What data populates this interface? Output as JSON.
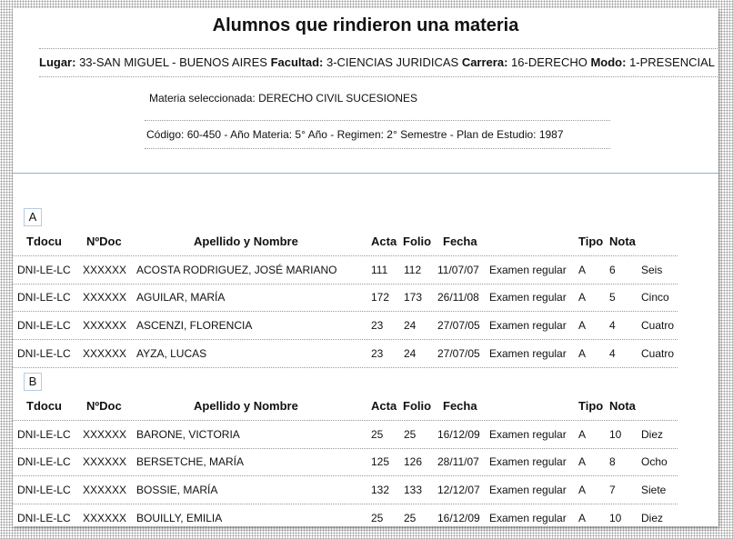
{
  "title": "Alumnos que rindieron una materia",
  "info": {
    "lugar_label": "Lugar:",
    "lugar_value": "33-SAN MIGUEL - BUENOS AIRES",
    "facultad_label": "Facultad:",
    "facultad_value": "3-CIENCIAS JURIDICAS",
    "carrera_label": "Carrera:",
    "carrera_value": "16-DERECHO",
    "modo_label": "Modo:",
    "modo_value": "1-PRESENCIAL"
  },
  "materia": "Materia seleccionada: DERECHO CIVIL SUCESIONES",
  "codigo": "Código: 60-450 - Año Materia: 5° Año - Regimen: 2° Semestre - Plan de Estudio: 1987",
  "columns": [
    "Tdocu",
    "NºDoc",
    "Apellido y Nombre",
    "Acta",
    "Folio",
    "Fecha",
    "Tipo",
    "Nota"
  ],
  "groups": [
    {
      "letter": "A",
      "rows": [
        {
          "tdocu": "DNI-LE-LC",
          "ndoc": "XXXXXX",
          "nombre": "ACOSTA RODRIGUEZ,  JOSÉ MARIANO",
          "acta": "111",
          "folio": "112",
          "fecha": "11/07/07",
          "examen": "Examen regular",
          "tipo": "A",
          "nota": "6",
          "nota_texto": "Seis"
        },
        {
          "tdocu": "DNI-LE-LC",
          "ndoc": "XXXXXX",
          "nombre": "AGUILAR, MARÍA",
          "acta": "172",
          "folio": "173",
          "fecha": "26/11/08",
          "examen": "Examen regular",
          "tipo": "A",
          "nota": "5",
          "nota_texto": "Cinco"
        },
        {
          "tdocu": "DNI-LE-LC",
          "ndoc": "XXXXXX",
          "nombre": "ASCENZI,  FLORENCIA",
          "acta": "23",
          "folio": "24",
          "fecha": "27/07/05",
          "examen": "Examen regular",
          "tipo": "A",
          "nota": "4",
          "nota_texto": "Cuatro"
        },
        {
          "tdocu": "DNI-LE-LC",
          "ndoc": "XXXXXX",
          "nombre": "AYZA, LUCAS",
          "acta": "23",
          "folio": "24",
          "fecha": "27/07/05",
          "examen": "Examen regular",
          "tipo": "A",
          "nota": "4",
          "nota_texto": "Cuatro"
        }
      ]
    },
    {
      "letter": "B",
      "rows": [
        {
          "tdocu": "DNI-LE-LC",
          "ndoc": "XXXXXX",
          "nombre": "BARONE, VICTORIA",
          "acta": "25",
          "folio": "25",
          "fecha": "16/12/09",
          "examen": "Examen regular",
          "tipo": "A",
          "nota": "10",
          "nota_texto": "Diez"
        },
        {
          "tdocu": "DNI-LE-LC",
          "ndoc": "XXXXXX",
          "nombre": "BERSETCHE, MARÍA",
          "acta": "125",
          "folio": "126",
          "fecha": "28/11/07",
          "examen": "Examen regular",
          "tipo": "A",
          "nota": "8",
          "nota_texto": "Ocho"
        },
        {
          "tdocu": "DNI-LE-LC",
          "ndoc": "XXXXXX",
          "nombre": "BOSSIE, MARÍA",
          "acta": "132",
          "folio": "133",
          "fecha": "12/12/07",
          "examen": "Examen regular",
          "tipo": "A",
          "nota": "7",
          "nota_texto": "Siete"
        },
        {
          "tdocu": "DNI-LE-LC",
          "ndoc": "XXXXXX",
          "nombre": "BOUILLY, EMILIA",
          "acta": "25",
          "folio": "25",
          "fecha": "16/12/09",
          "examen": "Examen regular",
          "tipo": "A",
          "nota": "10",
          "nota_texto": "Diez"
        }
      ]
    }
  ],
  "colors": {
    "divider": "#8fb0cc",
    "group_border": "#b8cbe0",
    "dotted_lines": "#999999"
  }
}
